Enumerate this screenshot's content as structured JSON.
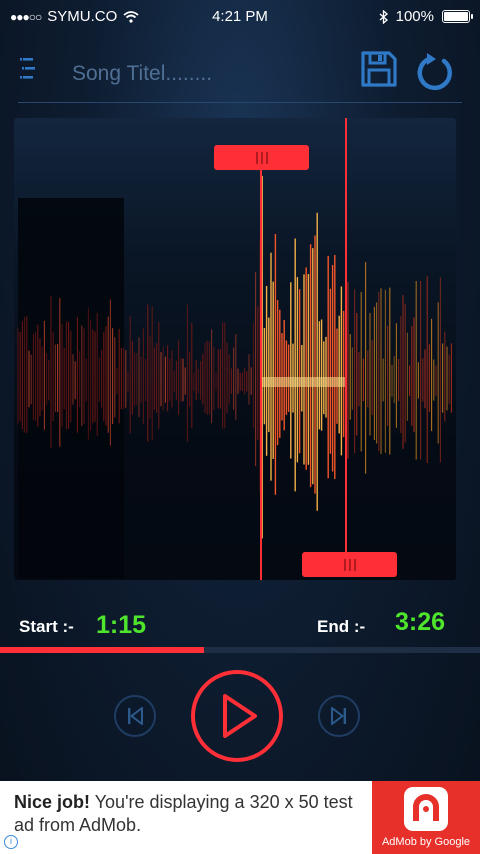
{
  "status_bar": {
    "carrier": "SYMU.CO",
    "time": "4:21 PM",
    "battery": "100%"
  },
  "header": {
    "song_title": "Song Titel........"
  },
  "trim": {
    "start_label": "Start :-",
    "start_time": "1:15",
    "end_label": "End :-",
    "end_time": "3:26",
    "progress": 0.425
  },
  "ad": {
    "headline": "Nice job!",
    "body": " You're displaying a 320 x 50 test ad from AdMob.",
    "brand": "AdMob by Google"
  },
  "colors": {
    "accent": "#ff2f37",
    "time_green": "#4fe52c",
    "icon_blue": "#2f79c7"
  }
}
